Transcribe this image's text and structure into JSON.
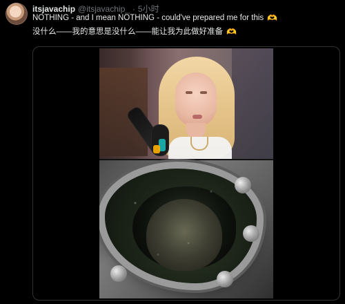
{
  "tweet": {
    "author": {
      "display_name": "itsjavachip",
      "handle": "@itsjavachip_",
      "separator": "·",
      "time": "5小时"
    },
    "text": {
      "line1_text": "NOTHING - and I mean NOTHING - could've prepared me for this",
      "line2_text": "没什么——我的意思是没什么——能让我为此做好准备",
      "emoji_face": "😩",
      "emoji_heart": "🫶"
    },
    "media": {
      "icons": [
        "video-preview-image"
      ]
    }
  }
}
